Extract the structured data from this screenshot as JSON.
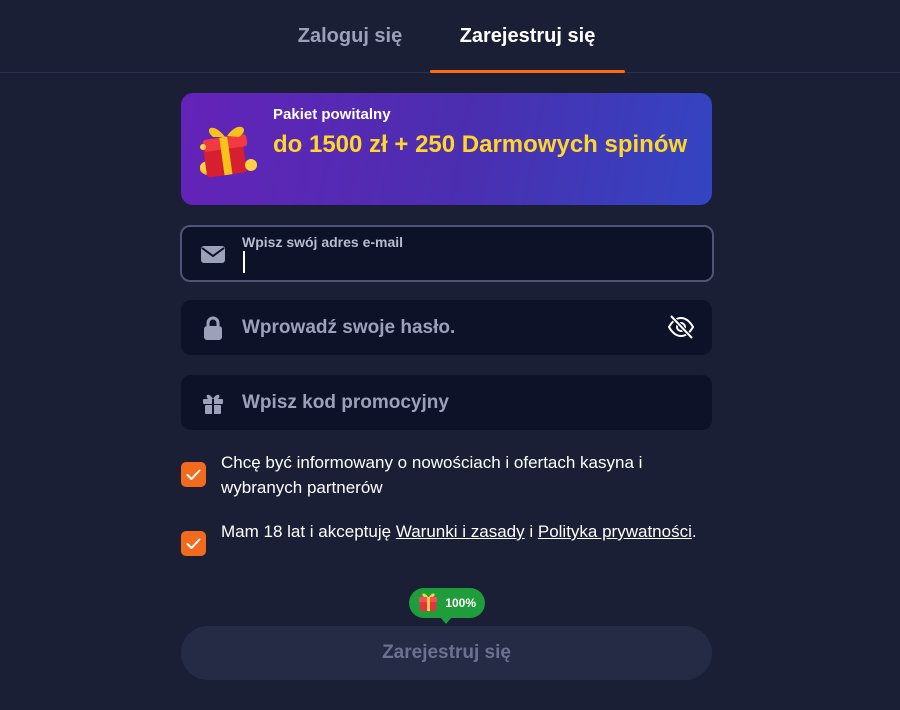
{
  "tabs": {
    "login": "Zaloguj się",
    "register": "Zarejestruj się"
  },
  "banner": {
    "subtitle": "Pakiet powitalny",
    "title": "do 1500 zł + 250 Darmowych spinów",
    "icon": "gift-icon"
  },
  "form": {
    "email": {
      "label": "Wpisz swój adres e-mail",
      "value": "",
      "icon": "envelope-icon"
    },
    "password": {
      "placeholder": "Wprowadź swoje hasło.",
      "icon": "lock-icon",
      "toggle_icon": "eye-off-icon"
    },
    "promo": {
      "placeholder": "Wpisz kod promocyjny",
      "icon": "gift-icon"
    },
    "consent_news": {
      "checked": true,
      "text": "Chcę być informowany o nowościach i ofertach kasyna i wybranych partnerów"
    },
    "consent_terms": {
      "checked": true,
      "prefix": "Mam 18 lat i akceptuję ",
      "terms_link": "Warunki i zasady",
      "middle": " i ",
      "privacy_link": "Polityka prywatności",
      "suffix": "."
    },
    "progress": {
      "label": "100%",
      "value": 100
    },
    "submit_label": "Zarejestruj się"
  },
  "colors": {
    "background": "#1a1f36",
    "accent": "#ff6a13",
    "banner_title": "#ffd72a",
    "progress": "#1f9d3a"
  }
}
